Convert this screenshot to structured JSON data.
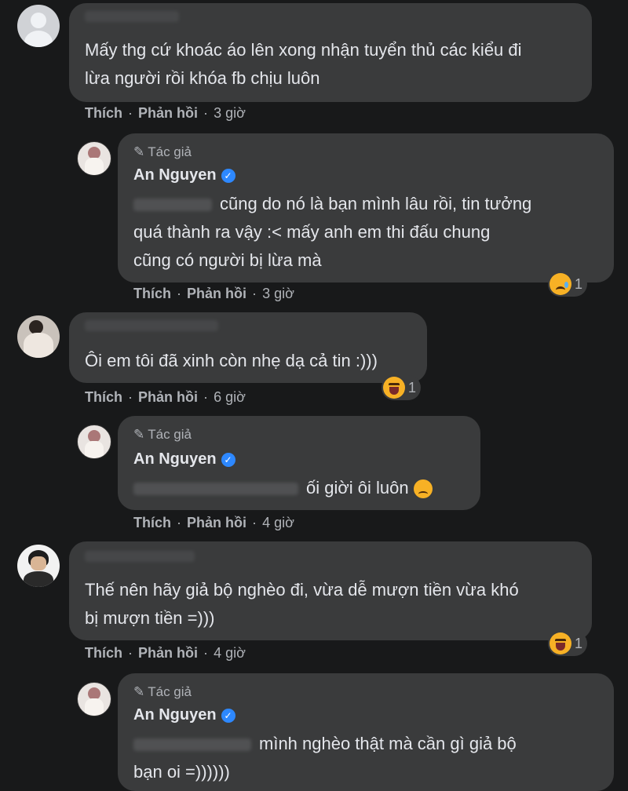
{
  "comments": [
    {
      "lines": [
        "Mấy thg cứ khoác áo lên xong nhận tuyển thủ các kiểu đi",
        "lừa người rồi khóa fb chịu luôn"
      ],
      "actions": {
        "like": "Thích",
        "reply": "Phản hồi",
        "time": "3 giờ"
      }
    },
    {
      "author_badge": "Tác giả",
      "author": "An Nguyen",
      "lines": [
        "cũng do nó là bạn mình lâu rồi, tin tưởng",
        "quá thành ra vậy :< mấy anh em thi đấu chung",
        "cũng có người bị lừa mà"
      ],
      "reaction": {
        "icon": "sad-emoji",
        "count": "1"
      },
      "actions": {
        "like": "Thích",
        "reply": "Phản hồi",
        "time": "3 giờ"
      }
    },
    {
      "lines": [
        "Ôi em tôi đã xinh còn nhẹ dạ cả tin :)))"
      ],
      "reaction": {
        "icon": "tongue-emoji",
        "count": "1"
      },
      "actions": {
        "like": "Thích",
        "reply": "Phản hồi",
        "time": "6 giờ"
      }
    },
    {
      "author_badge": "Tác giả",
      "author": "An Nguyen",
      "lines": [
        "ối giời ôi luôn"
      ],
      "actions": {
        "like": "Thích",
        "reply": "Phản hồi",
        "time": "4 giờ"
      }
    },
    {
      "lines": [
        "Thế nên hãy giả bộ nghèo đi, vừa dễ mượn tiền vừa khó",
        "bị mượn tiền =)))"
      ],
      "reaction": {
        "icon": "tongue-emoji",
        "count": "1"
      },
      "actions": {
        "like": "Thích",
        "reply": "Phản hồi",
        "time": "4 giờ"
      }
    },
    {
      "author_badge": "Tác giả",
      "author": "An Nguyen",
      "lines": [
        "mình nghèo thật mà cần gì giả bộ",
        "bạn oi =))))))"
      ]
    }
  ],
  "separator": "·"
}
